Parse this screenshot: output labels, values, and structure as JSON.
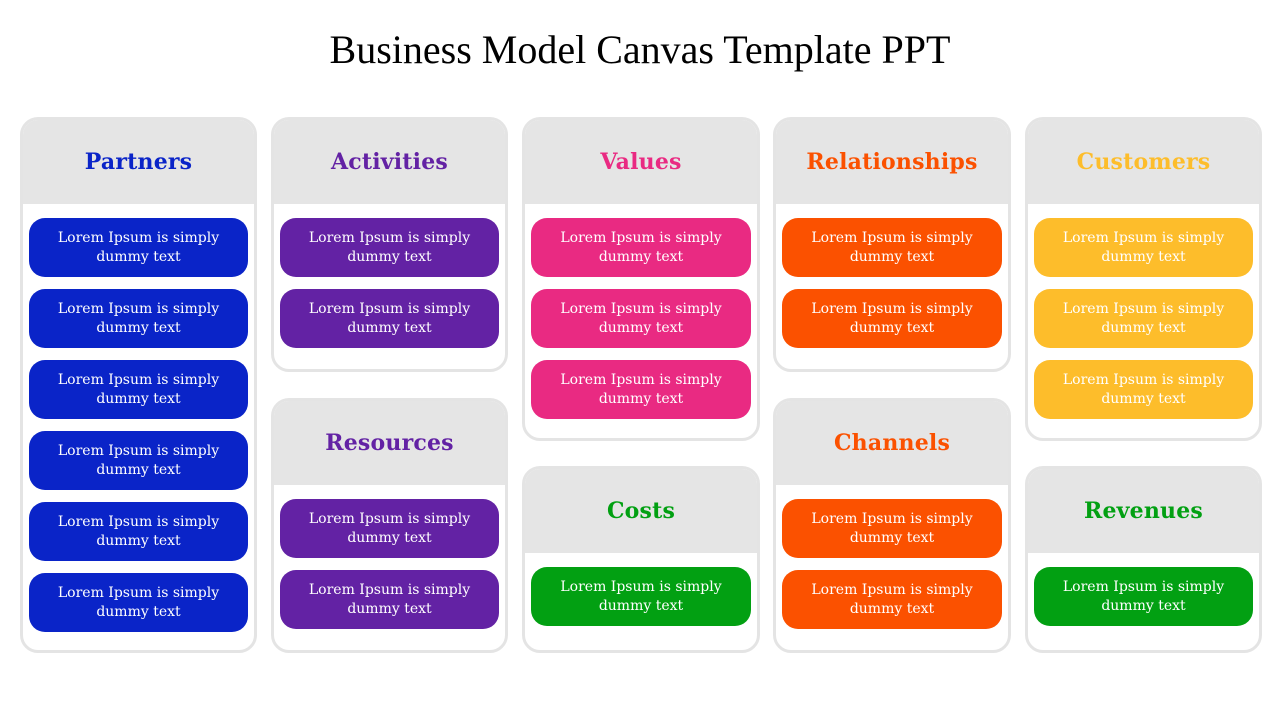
{
  "title": "Business Model Canvas Template PPT",
  "colors": {
    "blue": "#0a24c8",
    "purple": "#6322a4",
    "pink": "#e92a82",
    "orange": "#fb5100",
    "yellow": "#fdbd2b",
    "green": "#02a012"
  },
  "blocks": {
    "partners": {
      "title": "Partners",
      "items": [
        "Lorem Ipsum is simply dummy text",
        "Lorem Ipsum is simply dummy text",
        "Lorem Ipsum is simply dummy text",
        "Lorem Ipsum is simply dummy text",
        "Lorem Ipsum is simply dummy text",
        "Lorem Ipsum is simply dummy text"
      ]
    },
    "activities": {
      "title": "Activities",
      "items": [
        "Lorem Ipsum is simply dummy text",
        "Lorem Ipsum is simply dummy text"
      ]
    },
    "resources": {
      "title": "Resources",
      "items": [
        "Lorem Ipsum is simply dummy text",
        "Lorem Ipsum is simply dummy text"
      ]
    },
    "values": {
      "title": "Values",
      "items": [
        "Lorem Ipsum is simply dummy text",
        "Lorem Ipsum is simply dummy text",
        "Lorem Ipsum is simply dummy text"
      ]
    },
    "costs": {
      "title": "Costs",
      "items": [
        "Lorem Ipsum is simply dummy text"
      ]
    },
    "relationships": {
      "title": "Relationships",
      "items": [
        "Lorem Ipsum is simply dummy text",
        "Lorem Ipsum is simply dummy text"
      ]
    },
    "channels": {
      "title": "Channels",
      "items": [
        "Lorem Ipsum is simply dummy text",
        "Lorem Ipsum is simply dummy text"
      ]
    },
    "customers": {
      "title": "Customers",
      "items": [
        "Lorem Ipsum is simply dummy text",
        "Lorem Ipsum is simply dummy text",
        "Lorem Ipsum is simply dummy text"
      ]
    },
    "revenues": {
      "title": "Revenues",
      "items": [
        "Lorem Ipsum is simply dummy text"
      ]
    }
  }
}
